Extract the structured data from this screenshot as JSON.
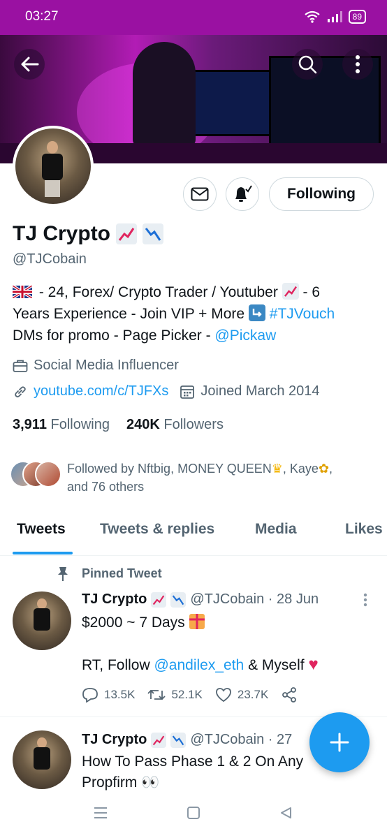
{
  "status_bar": {
    "time": "03:27",
    "battery": "89"
  },
  "profile": {
    "name": "TJ Crypto",
    "handle": "@TJCobain",
    "following_button": "Following",
    "bio_line1_a": "- 24, Forex/ Crypto Trader / Youtuber",
    "bio_line1_b": "- 6",
    "bio_line2_a": "Years Experience - Join VIP + More",
    "bio_hashtag": "#TJVouch",
    "bio_line3_a": "DMs for promo - Page Picker -",
    "bio_mention": "@Pickaw",
    "category": "Social Media Influencer",
    "website": "youtube.com/c/TJFXs",
    "joined": "Joined March 2014",
    "following_count": "3,911",
    "following_label": "Following",
    "followers_count": "240K",
    "followers_label": "Followers",
    "followed_by_a": "Followed by Nftbig, MONEY QUEEN",
    "followed_by_b": ", Kaye",
    "followed_by_c": ",",
    "followed_by_d": "and 76 others"
  },
  "tabs": [
    {
      "label": "Tweets"
    },
    {
      "label": "Tweets & replies"
    },
    {
      "label": "Media"
    },
    {
      "label": "Likes"
    }
  ],
  "pinned_label": "Pinned Tweet",
  "tweet1": {
    "name": "TJ Crypto",
    "handle_time": "@TJCobain · 28 Jun",
    "line1": "$2000 ~ 7 Days",
    "line2_a": "RT, Follow",
    "line2_mention": "@andilex_eth",
    "line2_b": "& Myself",
    "replies": "13.5K",
    "retweets": "52.1K",
    "likes": "23.7K"
  },
  "tweet2": {
    "name": "TJ Crypto",
    "handle_time": "@TJCobain · 27",
    "line1": "How To Pass Phase 1 & 2 On Any",
    "line2": "Propfirm"
  },
  "colors": {
    "accent": "#1d9bf0",
    "status_bar": "#9a11a2",
    "text": "#0f1419",
    "muted": "#536471"
  }
}
